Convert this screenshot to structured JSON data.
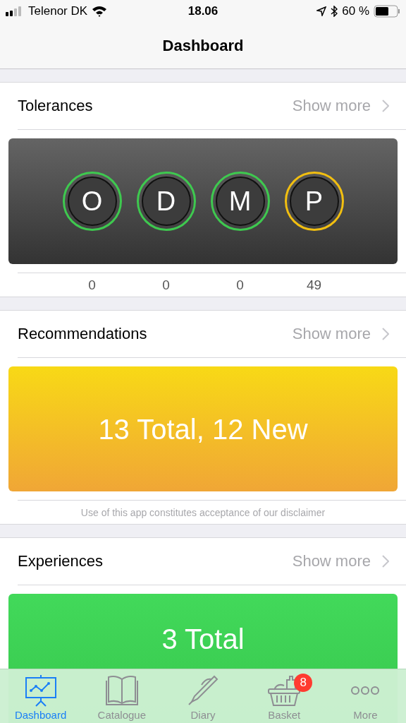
{
  "status_bar": {
    "carrier": "Telenor DK",
    "time": "18.06",
    "battery": "60 %"
  },
  "nav": {
    "title": "Dashboard"
  },
  "sections": [
    {
      "kind": "tolerances",
      "title": "Tolerances",
      "link": "Show more",
      "tolerances": [
        {
          "letter": "O",
          "count": "0",
          "color": "#3ec94f"
        },
        {
          "letter": "D",
          "count": "0",
          "color": "#3ec94f"
        },
        {
          "letter": "M",
          "count": "0",
          "color": "#3ec94f"
        },
        {
          "letter": "P",
          "count": "49",
          "color": "#f2bf10"
        }
      ]
    },
    {
      "kind": "recommendations",
      "title": "Recommendations",
      "link": "Show more",
      "lines": [
        "13 Total, 12 New"
      ],
      "footer": "Use of this app constitutes acceptance of our disclaimer"
    },
    {
      "kind": "experiences",
      "title": "Experiences",
      "link": "Show more",
      "lines": [
        "3 Total"
      ]
    }
  ],
  "tabs": [
    {
      "label": "Dashboard",
      "kind": "dashboard",
      "selected": true
    },
    {
      "label": "Catalogue",
      "kind": "catalogue",
      "selected": false
    },
    {
      "label": "Diary",
      "kind": "diary",
      "selected": false
    },
    {
      "label": "Basket",
      "kind": "basket",
      "selected": false,
      "badge": "8"
    },
    {
      "label": "More",
      "kind": "more",
      "selected": false
    }
  ]
}
